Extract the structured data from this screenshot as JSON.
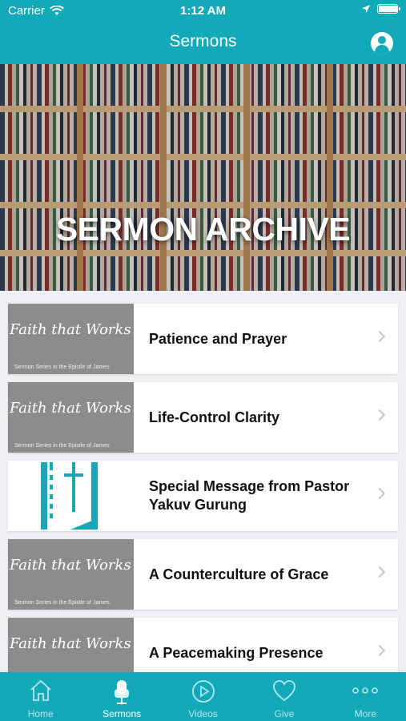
{
  "status": {
    "carrier": "Carrier",
    "time": "1:12 AM"
  },
  "nav": {
    "title": "Sermons"
  },
  "hero": {
    "title": "SERMON ARCHIVE"
  },
  "series_art": {
    "script": "Faith that Works",
    "subtitle": "Sermon Series in the Epistle of James"
  },
  "sermons": [
    {
      "title": "Patience and Prayer",
      "thumb": "series"
    },
    {
      "title": "Life-Control Clarity",
      "thumb": "series"
    },
    {
      "title": "Special Message from Pastor Yakuv Gurung",
      "thumb": "church-logo"
    },
    {
      "title": "A Counterculture of Grace",
      "thumb": "series"
    },
    {
      "title": "A Peacemaking Presence",
      "thumb": "series"
    }
  ],
  "tabs": [
    {
      "label": "Home",
      "icon": "home-icon",
      "active": false
    },
    {
      "label": "Sermons",
      "icon": "microphone-icon",
      "active": true
    },
    {
      "label": "Videos",
      "icon": "play-icon",
      "active": false
    },
    {
      "label": "Give",
      "icon": "heart-icon",
      "active": false
    },
    {
      "label": "More",
      "icon": "more-icon",
      "active": false
    }
  ],
  "colors": {
    "brand": "#12a9b8",
    "logo": "#1aa6b7"
  }
}
